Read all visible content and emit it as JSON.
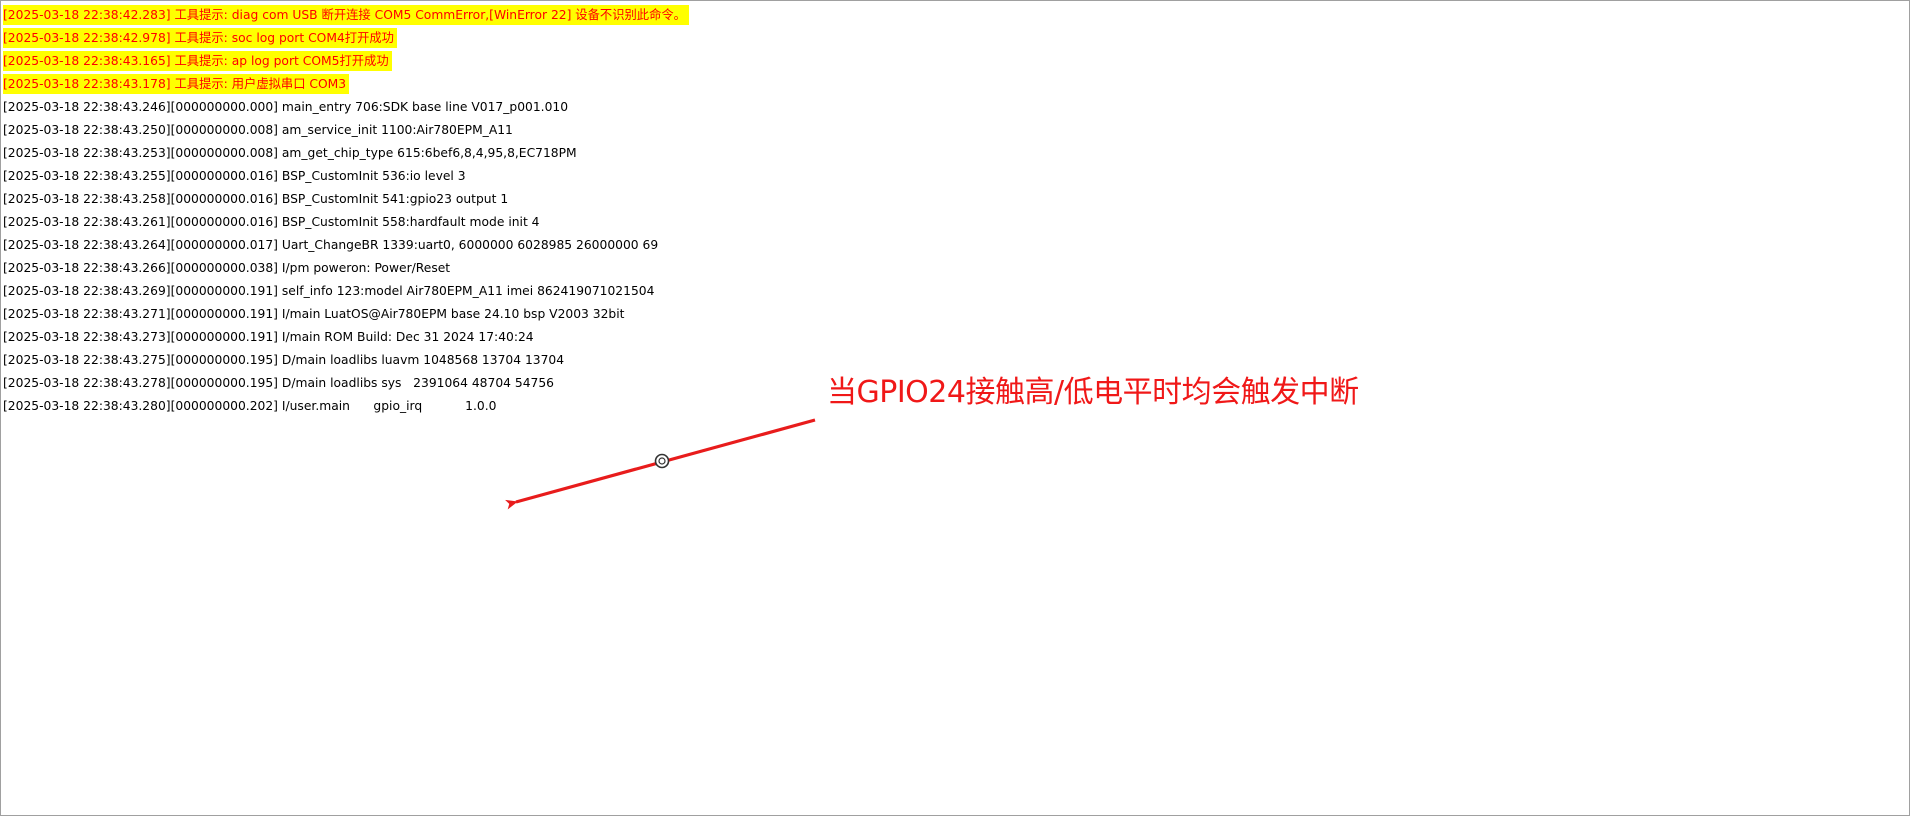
{
  "log": {
    "lines": [
      {
        "text": "[2025-03-18 22:38:42.283] 工具提示: diag com USB 断开连接 COM5 CommError,[WinError 22] 设备不识别此命令。",
        "highlight": true
      },
      {
        "text": "[2025-03-18 22:38:42.978] 工具提示: soc log port COM4打开成功",
        "highlight": true
      },
      {
        "text": "[2025-03-18 22:38:43.165] 工具提示: ap log port COM5打开成功",
        "highlight": true
      },
      {
        "text": "[2025-03-18 22:38:43.178] 工具提示: 用户虚拟串口 COM3",
        "highlight": true
      },
      {
        "text": "[2025-03-18 22:38:43.246][000000000.000] main_entry 706:SDK base line V017_p001.010",
        "highlight": false
      },
      {
        "text": "[2025-03-18 22:38:43.250][000000000.008] am_service_init 1100:Air780EPM_A11",
        "highlight": false
      },
      {
        "text": "[2025-03-18 22:38:43.253][000000000.008] am_get_chip_type 615:6bef6,8,4,95,8,EC718PM",
        "highlight": false
      },
      {
        "text": "[2025-03-18 22:38:43.255][000000000.016] BSP_CustomInit 536:io level 3",
        "highlight": false
      },
      {
        "text": "[2025-03-18 22:38:43.258][000000000.016] BSP_CustomInit 541:gpio23 output 1",
        "highlight": false
      },
      {
        "text": "[2025-03-18 22:38:43.261][000000000.016] BSP_CustomInit 558:hardfault mode init 4",
        "highlight": false
      },
      {
        "text": "[2025-03-18 22:38:43.264][000000000.017] Uart_ChangeBR 1339:uart0, 6000000 6028985 26000000 69",
        "highlight": false
      },
      {
        "text": "[2025-03-18 22:38:43.266][000000000.038] I/pm poweron: Power/Reset",
        "highlight": false
      },
      {
        "text": "[2025-03-18 22:38:43.269][000000000.191] self_info 123:model Air780EPM_A11 imei 862419071021504",
        "highlight": false
      },
      {
        "text": "[2025-03-18 22:38:43.271][000000000.191] I/main LuatOS@Air780EPM base 24.10 bsp V2003 32bit",
        "highlight": false
      },
      {
        "text": "[2025-03-18 22:38:43.273][000000000.191] I/main ROM Build: Dec 31 2024 17:40:24",
        "highlight": false
      },
      {
        "text": "[2025-03-18 22:38:43.275][000000000.195] D/main loadlibs luavm 1048568 13704 13704",
        "highlight": false
      },
      {
        "text": "[2025-03-18 22:38:43.278][000000000.195] D/main loadlibs sys   2391064 48704 54756",
        "highlight": false
      },
      {
        "text": "[2025-03-18 22:38:43.280][000000000.202] I/user.main      gpio_irq           1.0.0",
        "highlight": false
      }
    ]
  },
  "annotation": {
    "text": "当GPIO24接触高/低电平时均会触发中断",
    "color": "#f01818"
  },
  "colors": {
    "highlight_bg": "#ffff00",
    "highlight_fg": "#ff0000",
    "text": "#000000"
  }
}
